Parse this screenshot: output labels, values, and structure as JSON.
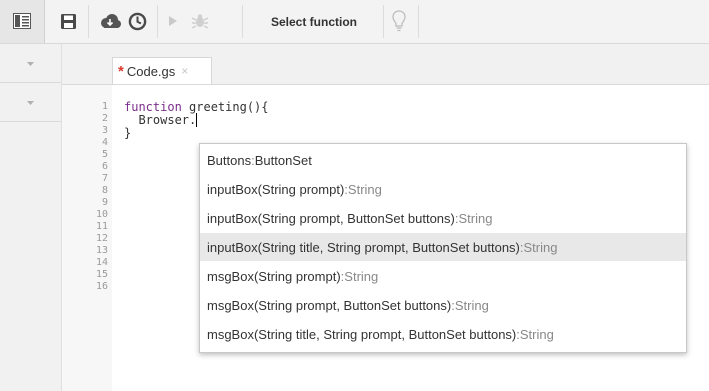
{
  "toolbar": {
    "select_function_label": "Select function"
  },
  "editor": {
    "tab": {
      "modified_marker": "*",
      "name": "Code.gs",
      "close_glyph": "×"
    },
    "line_numbers": [
      "1",
      "2",
      "3",
      "4",
      "5",
      "6",
      "7",
      "8",
      "9",
      "10",
      "11",
      "12",
      "13",
      "14",
      "15",
      "16"
    ],
    "code": {
      "line1_keyword": "function",
      "line1_rest": " greeting(){",
      "line2": "  Browser.",
      "line3": "}"
    }
  },
  "autocomplete": {
    "selected_index": 3,
    "items": [
      {
        "name": "Buttons",
        "type": "ButtonSet"
      },
      {
        "name": "inputBox(String prompt)",
        "type": "String"
      },
      {
        "name": "inputBox(String prompt, ButtonSet buttons)",
        "type": "String"
      },
      {
        "name": "inputBox(String title, String prompt, ButtonSet buttons)",
        "type": "String"
      },
      {
        "name": "msgBox(String prompt)",
        "type": "String"
      },
      {
        "name": "msgBox(String prompt, ButtonSet buttons)",
        "type": "String"
      },
      {
        "name": "msgBox(String title, String prompt, ButtonSet buttons)",
        "type": "String"
      }
    ],
    "separator": " : "
  },
  "icons": {
    "outline": "outline-icon",
    "save": "save-icon",
    "cloud": "cloud-icon",
    "clock": "triggers-clock-icon",
    "run": "run-play-icon",
    "debug": "debug-bug-icon",
    "bulb": "lightbulb-icon",
    "collapse": "chevron-down-icon"
  }
}
